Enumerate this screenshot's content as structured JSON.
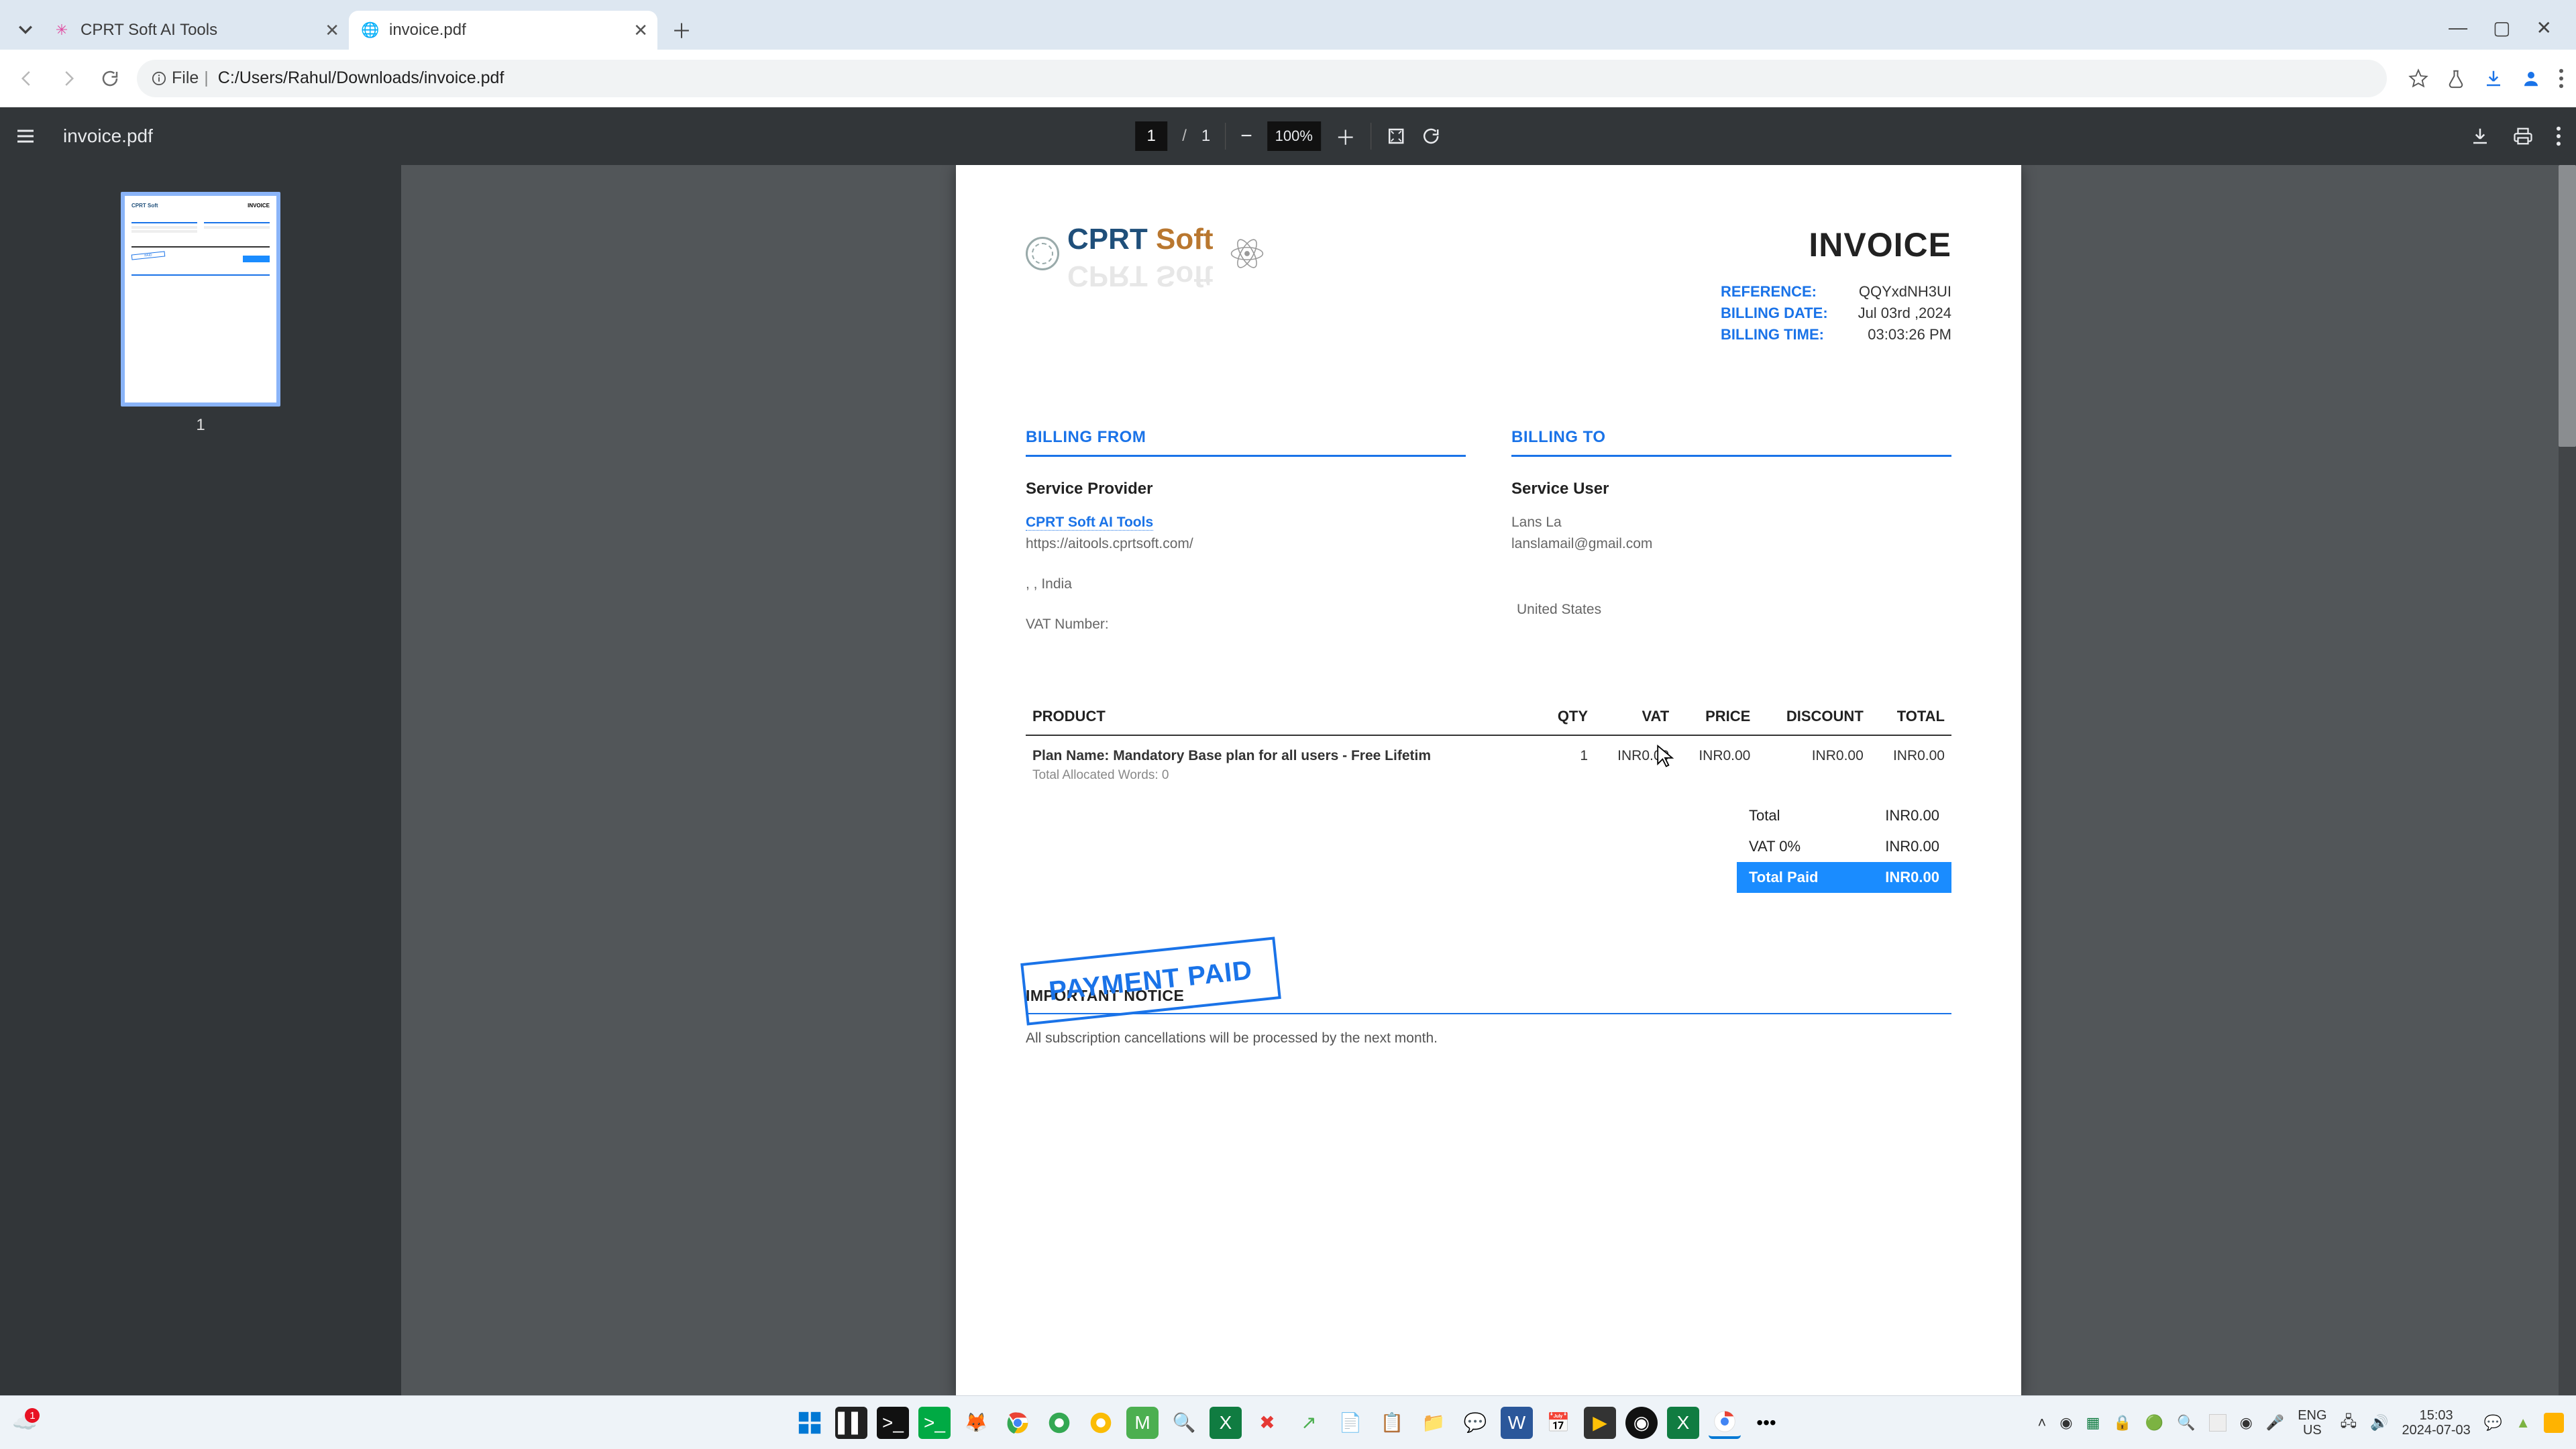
{
  "browser": {
    "tabs": [
      {
        "title": "CPRT Soft AI Tools",
        "active": false,
        "favicon": "✳"
      },
      {
        "title": "invoice.pdf",
        "active": true,
        "favicon": "◐"
      }
    ],
    "url_scheme": "File",
    "url_path": "C:/Users/Rahul/Downloads/invoice.pdf"
  },
  "pdf_toolbar": {
    "doc_name": "invoice.pdf",
    "page_current": "1",
    "page_sep": "/",
    "page_total": "1",
    "zoom": "100%"
  },
  "thumbnail": {
    "page_label": "1"
  },
  "invoice": {
    "brand_cprt": "CPRT",
    "brand_soft": " Soft",
    "title": "INVOICE",
    "meta": {
      "reference_label": "REFERENCE:",
      "reference_value": "QQYxdNH3UI",
      "billing_date_label": "BILLING DATE:",
      "billing_date_value": "Jul 03rd ,2024",
      "billing_time_label": "BILLING TIME:",
      "billing_time_value": "03:03:26 PM"
    },
    "billing_from": {
      "heading": "BILLING FROM",
      "role": "Service Provider",
      "name": "CPRT Soft AI Tools",
      "url": "https://aitools.cprtsoft.com/",
      "addr": ", , India",
      "vat_label": "VAT Number:"
    },
    "billing_to": {
      "heading": "BILLING TO",
      "role": "Service User",
      "name": "Lans La",
      "email": "lanslamail@gmail.com",
      "country": "United States"
    },
    "columns": {
      "product": "PRODUCT",
      "qty": "QTY",
      "vat": "VAT",
      "price": "PRICE",
      "discount": "DISCOUNT",
      "total": "TOTAL"
    },
    "line_item": {
      "name": "Plan Name: Mandatory Base plan for all users -  Free Lifetim",
      "sub": "Total Allocated Words: 0",
      "qty": "1",
      "vat": "INR0.00",
      "price": "INR0.00",
      "discount": "INR0.00",
      "total": "INR0.00"
    },
    "totals": {
      "total_label": "Total",
      "total_value": "INR0.00",
      "vat_label": "VAT 0%",
      "vat_value": "INR0.00",
      "paid_label": "Total Paid",
      "paid_value": "INR0.00"
    },
    "stamp": "PAYMENT PAID",
    "notice_heading": "IMPORTANT NOTICE",
    "notice_body": "All subscription cancellations will be processed by the next month."
  },
  "taskbar": {
    "lang1": "ENG",
    "lang2": "US",
    "time": "15:03",
    "date": "2024-07-03",
    "badge": "1"
  }
}
